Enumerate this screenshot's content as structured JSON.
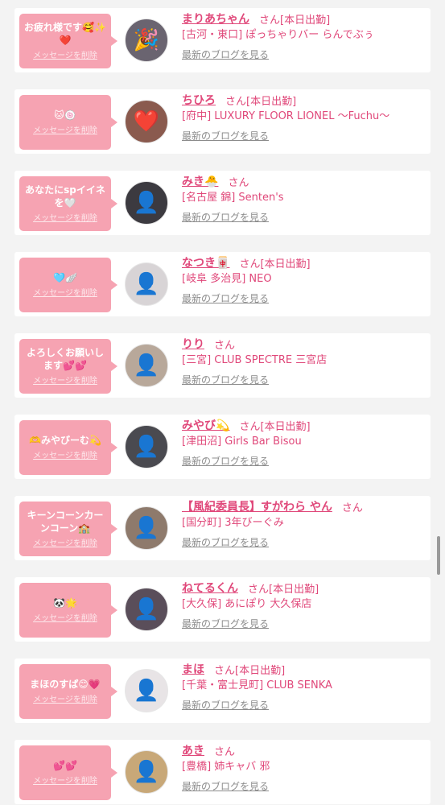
{
  "labels": {
    "delete_message": "メッセージを削除",
    "latest_blog": "最新のブログを見る"
  },
  "cards": [
    {
      "message": "お疲れ様です🥰✨❤️",
      "name": "まりあちゃん",
      "suffix": "さん[本日出勤]",
      "store": "[古河・東口] ぽっちゃりバー らんでぶぅ",
      "avatar_icon": "🎉",
      "avatar_bg": "#6a6470"
    },
    {
      "message": "🐱🍥",
      "name": "ちひろ",
      "suffix": "さん[本日出勤]",
      "store": "[府中] LUXURY FLOOR LIONEL 〜Fuchu〜",
      "avatar_icon": "❤️",
      "avatar_bg": "#8a5a4e"
    },
    {
      "message": "あなたにspイイネを🤍",
      "name": "みき🐣",
      "suffix": "さん",
      "store": "[名古屋 錦] Senten's",
      "avatar_icon": "👤",
      "avatar_bg": "#3c3a40"
    },
    {
      "message": "🩵🪽",
      "name": "なつき🀄",
      "suffix": "さん[本日出勤]",
      "store": "[岐阜 多治見] NEO",
      "avatar_icon": "👤",
      "avatar_bg": "#d8d4d6"
    },
    {
      "message": "よろしくお願いします💕💕",
      "name": "りり",
      "suffix": "さん",
      "store": "[三宮] CLUB SPECTRE 三宮店",
      "avatar_icon": "👤",
      "avatar_bg": "#b8a89a"
    },
    {
      "message": "🫶みやびーむ💫",
      "name": "みやび💫",
      "suffix": "さん[本日出勤]",
      "store": "[津田沼] Girls Bar Bisou",
      "avatar_icon": "👤",
      "avatar_bg": "#4a4a50"
    },
    {
      "message": "キーンコーンカーンコーン🏫",
      "name": "【風紀委員長】すがわら やん",
      "suffix": "さん",
      "store": "[国分町] 3年びーぐみ",
      "avatar_icon": "👤",
      "avatar_bg": "#8e7a6c"
    },
    {
      "message": "🐼🌟",
      "name": "ねてるくん",
      "suffix": "さん[本日出勤]",
      "store": "[大久保] あにぽり 大久保店",
      "avatar_icon": "👤",
      "avatar_bg": "#5a4e5a"
    },
    {
      "message": "まほのすぱ😊💗",
      "name": "まほ",
      "suffix": "さん[本日出勤]",
      "store": "[千葉・富士見町] CLUB SENKA",
      "avatar_icon": "👤",
      "avatar_bg": "#e8e4e6"
    },
    {
      "message": "💕💕",
      "name": "あき",
      "suffix": "さん",
      "store": "[豊橋] 姉キャバ 邪",
      "avatar_icon": "👤",
      "avatar_bg": "#c8a878"
    }
  ]
}
